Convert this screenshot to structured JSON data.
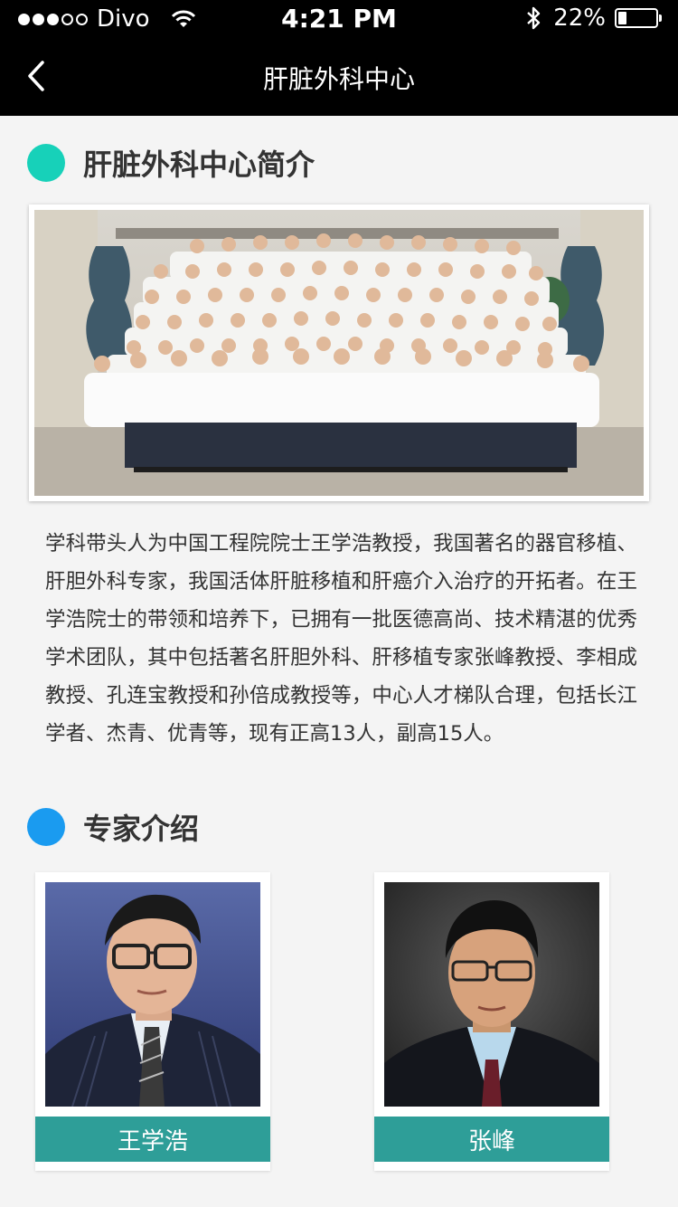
{
  "status_bar": {
    "carrier": "Divo",
    "signal_filled": 3,
    "signal_total": 5,
    "time": "4:21 PM",
    "battery_percent_text": "22%",
    "battery_level": 0.22,
    "icons": [
      "wifi-icon",
      "bluetooth-icon",
      "battery-icon"
    ]
  },
  "nav": {
    "title": "肝脏外科中心",
    "back_icon": "chevron-left-icon"
  },
  "intro_section": {
    "title": "肝脏外科中心简介",
    "dot_color": "#17d1b9",
    "text": "学科带头人为中国工程院院士王学浩教授，我国著名的器官移植、肝胆外科专家，我国活体肝脏移植和肝癌介入治疗的开拓者。在王学浩院士的带领和培养下，已拥有一批医德高尚、技术精湛的优秀学术团队，其中包括著名肝胆外科、肝移植专家张峰教授、李相成教授、孔连宝教授和孙倍成教授等，中心人才梯队合理，包括长江学者、杰青、优青等，现有正高13人，副高15人。"
  },
  "experts_section": {
    "title": "专家介绍",
    "dot_color": "#1a9bf0",
    "experts": [
      {
        "name": "王学浩"
      },
      {
        "name": "张峰"
      }
    ]
  },
  "colors": {
    "bar_background": "#000000",
    "page_background": "#f4f4f4",
    "name_label": "#2e9e98"
  }
}
